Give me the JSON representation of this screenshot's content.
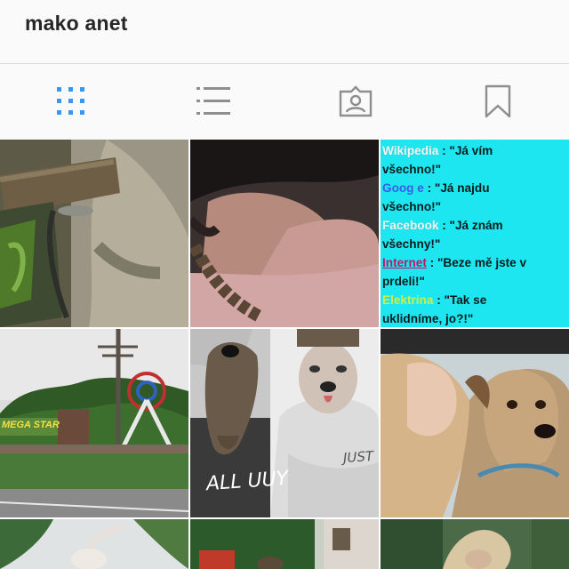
{
  "profile": {
    "username": "mako anet"
  },
  "tabs": [
    {
      "name": "grid-icon",
      "active": true
    },
    {
      "name": "list-icon",
      "active": false
    },
    {
      "name": "tagged-icon",
      "active": false
    },
    {
      "name": "saved-icon",
      "active": false
    }
  ],
  "colors": {
    "active": "#3897f0",
    "inactive": "#8e8e8e",
    "meme_bg": "#1ee6f0"
  },
  "posts": {
    "meme": {
      "line1_label": "Wikipedia",
      "line1_text": " : \"Já vím",
      "line2": "všechno!\"",
      "line3_label": "Goog e",
      "line3_text": " : \"Já najdu",
      "line4": "všechno!\"",
      "line5_label": "Facebook",
      "line5_text": " : \"Já znám",
      "line6": "všechny!\"",
      "line7_label": "Internet",
      "line7_text": " : \"Beze mě jste v",
      "line8": "prdeli!\"",
      "line9_label": "Elektrina",
      "line9_text": " : \"Tak se",
      "line10": "uklidníme, jo?!\""
    },
    "amusement_sign": "MEGA STAR",
    "shirt_text": "ALL UUY",
    "sweater_text": "JUST"
  }
}
